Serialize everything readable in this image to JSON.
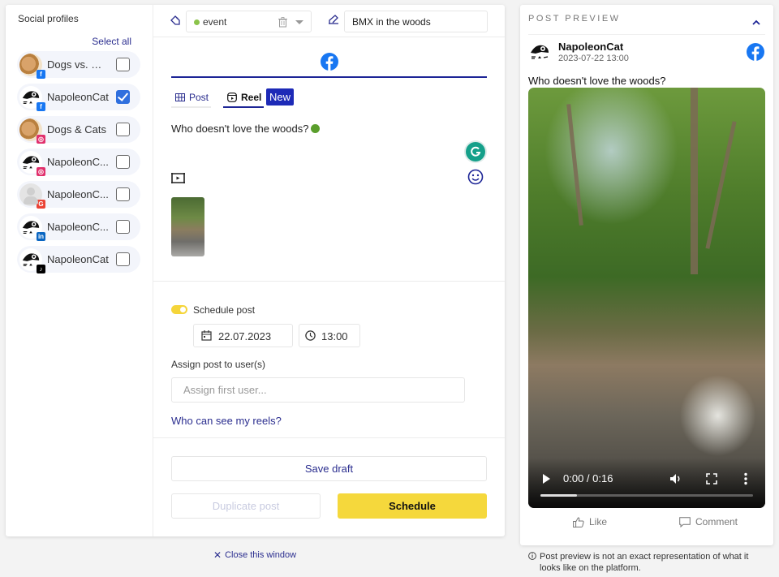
{
  "profiles": {
    "title": "Social profiles",
    "select_all": "Select all",
    "items": [
      {
        "name": "Dogs vs. Cats",
        "display": "Dogs vs. Ca...",
        "network": "facebook",
        "avatar": "dog",
        "checked": false
      },
      {
        "name": "NapoleonCat",
        "display": "NapoleonCat",
        "network": "facebook",
        "avatar": "napoleoncat",
        "checked": true
      },
      {
        "name": "Dogs & Cats",
        "display": "Dogs & Cats",
        "network": "instagram",
        "avatar": "dog",
        "checked": false
      },
      {
        "name": "NapoleonCat",
        "display": "NapoleonC...",
        "network": "instagram",
        "avatar": "napoleoncat",
        "checked": false
      },
      {
        "name": "NapoleonCat",
        "display": "NapoleonC...",
        "network": "google",
        "avatar": "default",
        "checked": false
      },
      {
        "name": "NapoleonCat",
        "display": "NapoleonC...",
        "network": "linkedin",
        "avatar": "napoleoncat",
        "checked": false
      },
      {
        "name": "NapoleonCat",
        "display": "NapoleonCat",
        "network": "tiktok",
        "avatar": "napoleoncat",
        "checked": false
      }
    ]
  },
  "editor": {
    "tag": {
      "label": "event",
      "color": "#8bc34a"
    },
    "title_value": "BMX in the woods",
    "network_icon": "facebook-icon",
    "tabs": [
      {
        "label": "Post",
        "icon": "grid-icon",
        "active": false
      },
      {
        "label": "Reel",
        "icon": "reel-icon",
        "active": true
      }
    ],
    "new_badge": "New",
    "post_text": "Who doesn't love the woods?",
    "schedule_label": "Schedule post",
    "schedule_enabled": true,
    "date": "22.07.2023",
    "time": "13:00",
    "assign_label": "Assign post to user(s)",
    "assign_placeholder": "Assign first user...",
    "who_link": "Who can see my reels?",
    "save_draft": "Save draft",
    "duplicate": "Duplicate post",
    "schedule": "Schedule",
    "close": "Close this window"
  },
  "preview": {
    "title": "POST PREVIEW",
    "account": "NapoleonCat",
    "datetime": "2023-07-22 13:00",
    "text": "Who doesn't love the woods?",
    "video": {
      "current": "0:00",
      "duration": "0:16",
      "time_readout": "0:00 / 0:16",
      "buffered_fraction": 0.17
    },
    "like": "Like",
    "comment": "Comment",
    "disclaimer": "Post preview is not an exact representation of what it looks like on the platform."
  },
  "colors": {
    "accent_navy": "#1d2596",
    "link": "#2b2e8f",
    "schedule_yellow": "#f5d83c",
    "facebook": "#1877f2",
    "checkbox_blue": "#2f6fde"
  }
}
